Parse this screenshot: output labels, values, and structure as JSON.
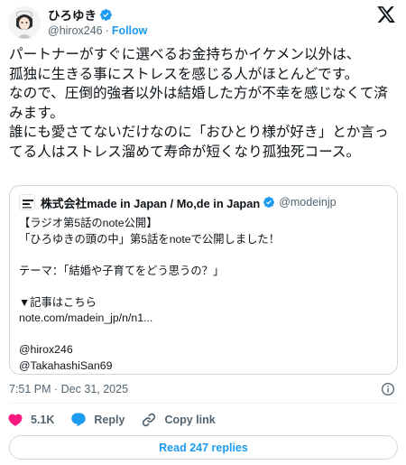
{
  "author": {
    "name": "ひろゆき",
    "handle": "@hirox246",
    "separator": "·",
    "follow_label": "Follow",
    "verified_color": "#1d9bf0"
  },
  "tweet": {
    "text": "パートナーがすぐに選べるお金持ちかイケメン以外は、\n孤独に生きる事にストレスを感じる人がほとんどです。\nなので、圧倒的強者以外は結婚した方が不幸を感じなくて済みます。\n誰にも愛さてないだけなのに「おひとり様が好き」とか言ってる人はストレス溜めて寿命が短くなり孤独死コース。"
  },
  "quote": {
    "name": "株式会社made in Japan / Mo,de in Japan",
    "handle": "@modeinjp",
    "text": "【ラジオ第5話のnote公開】\n「ひろゆきの頭の中」第5話をnoteで公開しました！\n\nテーマ：「結婚や子育てをどう思うの？」\n\n▼記事はこちら\nnote.com/madein_jp/n/n1...\n\n@hirox246\n@TakahashiSan69"
  },
  "meta": {
    "timestamp": "7:51 PM · Dec 31, 2025"
  },
  "actions": {
    "likes": "5.1K",
    "reply_label": "Reply",
    "copy_label": "Copy link"
  },
  "replies_button": "Read 247 replies",
  "colors": {
    "accent": "#1d9bf0",
    "like": "#f91880",
    "muted": "#536471",
    "border": "#cfd9de"
  },
  "icons": [
    "verified-badge-icon",
    "x-logo-icon",
    "info-icon",
    "heart-icon",
    "reply-bubble-icon",
    "link-icon"
  ]
}
